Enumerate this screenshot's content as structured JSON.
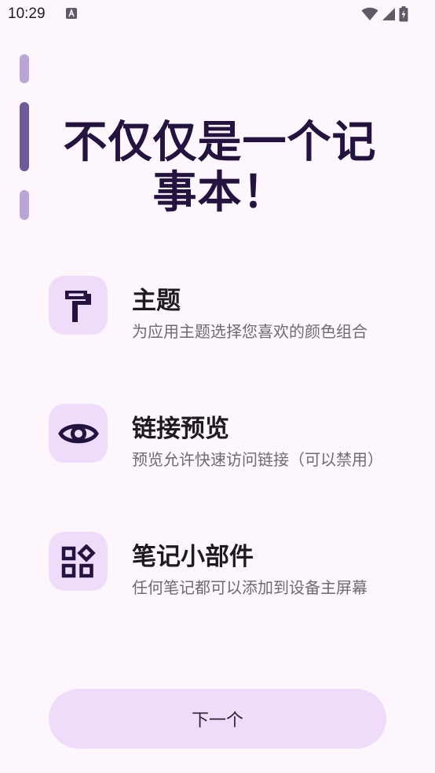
{
  "status_bar": {
    "time": "10:29",
    "icons": [
      "notification-a-icon",
      "wifi-icon",
      "cellular-icon",
      "battery-charging-icon"
    ]
  },
  "onboarding": {
    "headline": "不仅仅是一个记事本！",
    "page_indicator": {
      "count": 3,
      "active_index": 1
    },
    "features": [
      {
        "icon": "paint-roller-icon",
        "title": "主题",
        "description": "为应用主题选择您喜欢的颜色组合"
      },
      {
        "icon": "eye-icon",
        "title": "链接预览",
        "description": "预览允许快速访问链接（可以禁用）"
      },
      {
        "icon": "widgets-icon",
        "title": "笔记小部件",
        "description": "任何笔记都可以添加到设备主屏幕"
      }
    ],
    "next_button_label": "下一个"
  },
  "colors": {
    "background": "#fdf7fd",
    "accent_container": "#eedcfa",
    "headline": "#23133f",
    "icon": "#23133f",
    "indicator_active": "#6d5a97",
    "indicator_inactive": "#b9a6d6"
  }
}
